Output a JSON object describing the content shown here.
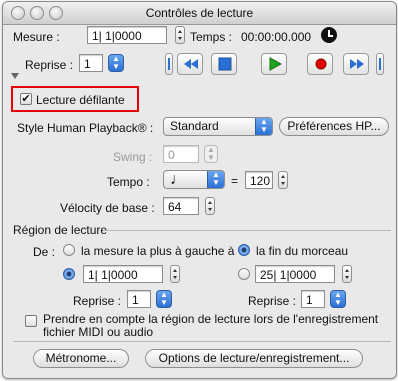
{
  "window": {
    "title": "Contrôles de lecture"
  },
  "mesure": {
    "label": "Mesure :",
    "value": "1| 1|0000"
  },
  "temps": {
    "label": "Temps :",
    "value": "00:00:00.000"
  },
  "reprise": {
    "label": "Reprise :",
    "value": "1"
  },
  "lecture_defilante": {
    "label": "Lecture défilante",
    "checked": true
  },
  "style": {
    "label": "Style Human Playback® :",
    "value": "Standard",
    "prefs_button": "Préférences HP..."
  },
  "swing": {
    "label": "Swing :",
    "value": "0"
  },
  "tempo": {
    "label": "Tempo :",
    "note": "♩",
    "equals": "=",
    "value": "120"
  },
  "velocite": {
    "label": "Vélocity de base :",
    "value": "64"
  },
  "region": {
    "title": "Région de lecture",
    "de_label": "De :",
    "opt_left": "la mesure la plus à gauche à",
    "opt_end": "la fin du morceau",
    "start_value": "1| 1|0000",
    "end_value": "25| 1|0000",
    "reprise_label_left": "Reprise :",
    "reprise_value_left": "1",
    "reprise_label_right": "Reprise :",
    "reprise_value_right": "1",
    "midi_checkbox_line1": "Prendre en compte la région de lecture lors de l'enregistrement",
    "midi_checkbox_line2": "fichier MIDI ou audio"
  },
  "bottom": {
    "metronome": "Métronome...",
    "options": "Options de lecture/enregistrement..."
  },
  "colors": {
    "highlight_box": "#e8000b",
    "accent_blue": "#2b6fd6",
    "play_green": "#1fa61f",
    "record_red": "#e00000"
  }
}
